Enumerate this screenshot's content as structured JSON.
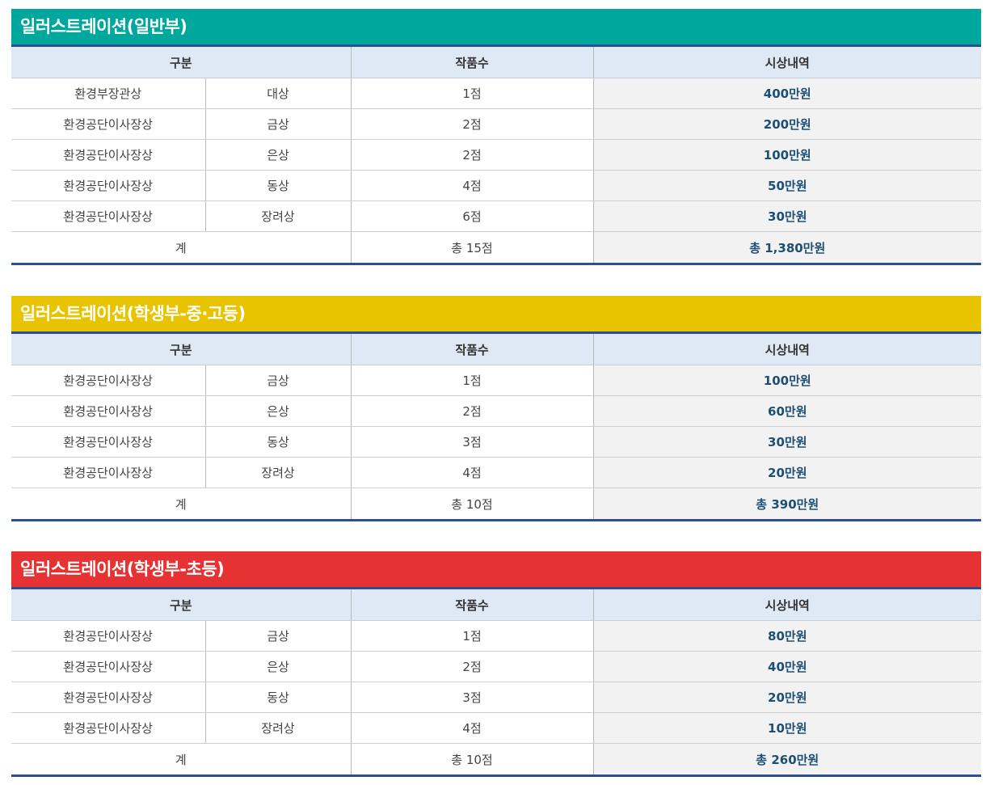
{
  "header_labels": {
    "category": "구분",
    "count": "작품수",
    "prize": "시상내역"
  },
  "sections": [
    {
      "title": "일러스트레이션(일반부)",
      "color": "#00a79d",
      "rows": [
        {
          "org": "환경부장관상",
          "award": "대상",
          "count": "1점",
          "prize": "400만원"
        },
        {
          "org": "환경공단이사장상",
          "award": "금상",
          "count": "2점",
          "prize": "200만원"
        },
        {
          "org": "환경공단이사장상",
          "award": "은상",
          "count": "2점",
          "prize": "100만원"
        },
        {
          "org": "환경공단이사장상",
          "award": "동상",
          "count": "4점",
          "prize": "50만원"
        },
        {
          "org": "환경공단이사장상",
          "award": "장려상",
          "count": "6점",
          "prize": "30만원"
        }
      ],
      "total": {
        "label": "계",
        "count": "총 15점",
        "prize": "총 1,380만원"
      }
    },
    {
      "title": "일러스트레이션(학생부-중·고등)",
      "color": "#e8c300",
      "rows": [
        {
          "org": "환경공단이사장상",
          "award": "금상",
          "count": "1점",
          "prize": "100만원"
        },
        {
          "org": "환경공단이사장상",
          "award": "은상",
          "count": "2점",
          "prize": "60만원"
        },
        {
          "org": "환경공단이사장상",
          "award": "동상",
          "count": "3점",
          "prize": "30만원"
        },
        {
          "org": "환경공단이사장상",
          "award": "장려상",
          "count": "4점",
          "prize": "20만원"
        }
      ],
      "total": {
        "label": "계",
        "count": "총 10점",
        "prize": "총 390만원"
      }
    },
    {
      "title": "일러스트레이션(학생부-초등)",
      "color": "#e63232",
      "rows": [
        {
          "org": "환경공단이사장상",
          "award": "금상",
          "count": "1점",
          "prize": "80만원"
        },
        {
          "org": "환경공단이사장상",
          "award": "은상",
          "count": "2점",
          "prize": "40만원"
        },
        {
          "org": "환경공단이사장상",
          "award": "동상",
          "count": "3점",
          "prize": "20만원"
        },
        {
          "org": "환경공단이사장상",
          "award": "장려상",
          "count": "4점",
          "prize": "10만원"
        }
      ],
      "total": {
        "label": "계",
        "count": "총 10점",
        "prize": "총 260만원"
      }
    }
  ]
}
